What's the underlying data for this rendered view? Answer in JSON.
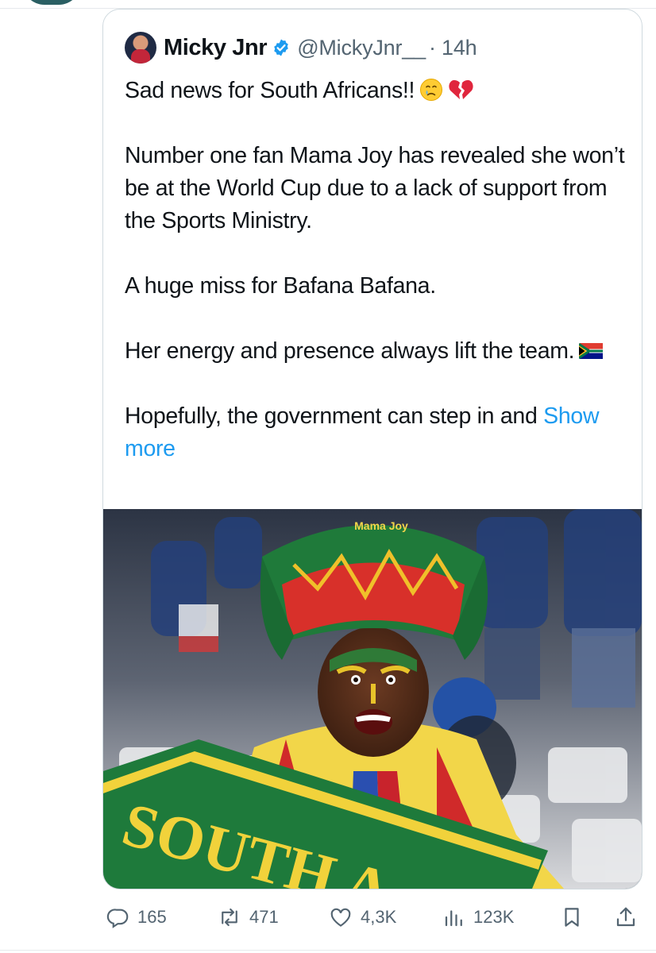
{
  "tweet": {
    "author_name": "Micky Jnr",
    "handle": "@MickyJnr__",
    "time": "· 14h",
    "paragraphs": [
      "Sad news for South Africans!!",
      "Number one fan Mama Joy has revealed she won’t be at the World Cup due to a lack of support from the Sports Ministry.",
      "A huge miss for Bafana Bafana.",
      "Her energy and presence always lift the team.",
      "Hopefully, the government can step in and"
    ],
    "show_more": "Show more",
    "emojis": [
      "crying-face-emoji",
      "broken-heart-emoji",
      "south-africa-flag-emoji"
    ],
    "media": {
      "hat_text": "Mama Joy",
      "scarf_text": "SOUTH A"
    }
  },
  "actions": {
    "replies": "165",
    "reposts": "471",
    "likes": "4,3K",
    "views": "123K"
  },
  "colors": {
    "link": "#1d9bf0",
    "secondary_text": "#536471",
    "verified": "#1d9bf0",
    "border": "#cfd9de"
  }
}
